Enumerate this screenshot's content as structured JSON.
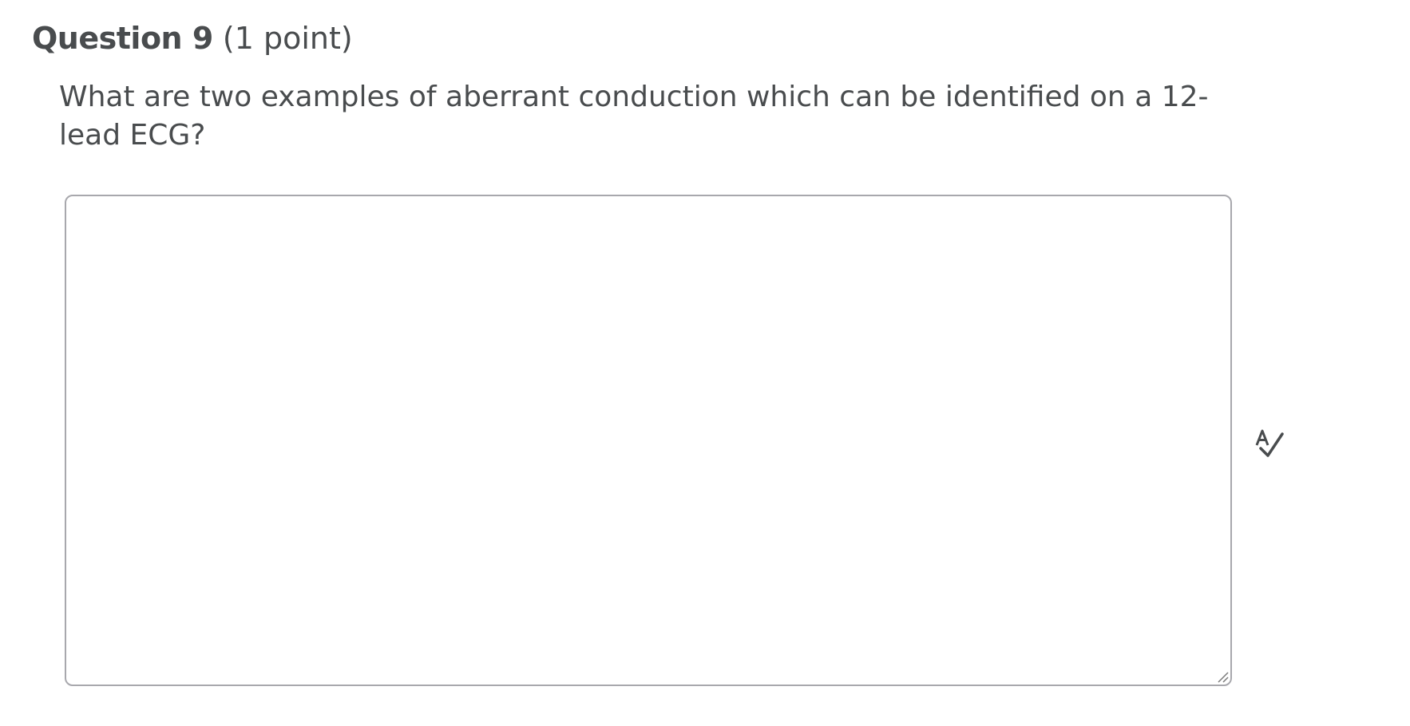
{
  "question": {
    "title": "Question 9",
    "points": "(1 point)",
    "prompt": "What are two examples of aberrant conduction which can be identified on a 12-lead ECG?"
  },
  "answer": {
    "value": "",
    "placeholder": ""
  },
  "icons": {
    "spellcheck": "spellcheck-icon",
    "resize": "resize-grip-icon"
  },
  "colors": {
    "text": "#494c4e",
    "border": "#a8a8ad"
  }
}
